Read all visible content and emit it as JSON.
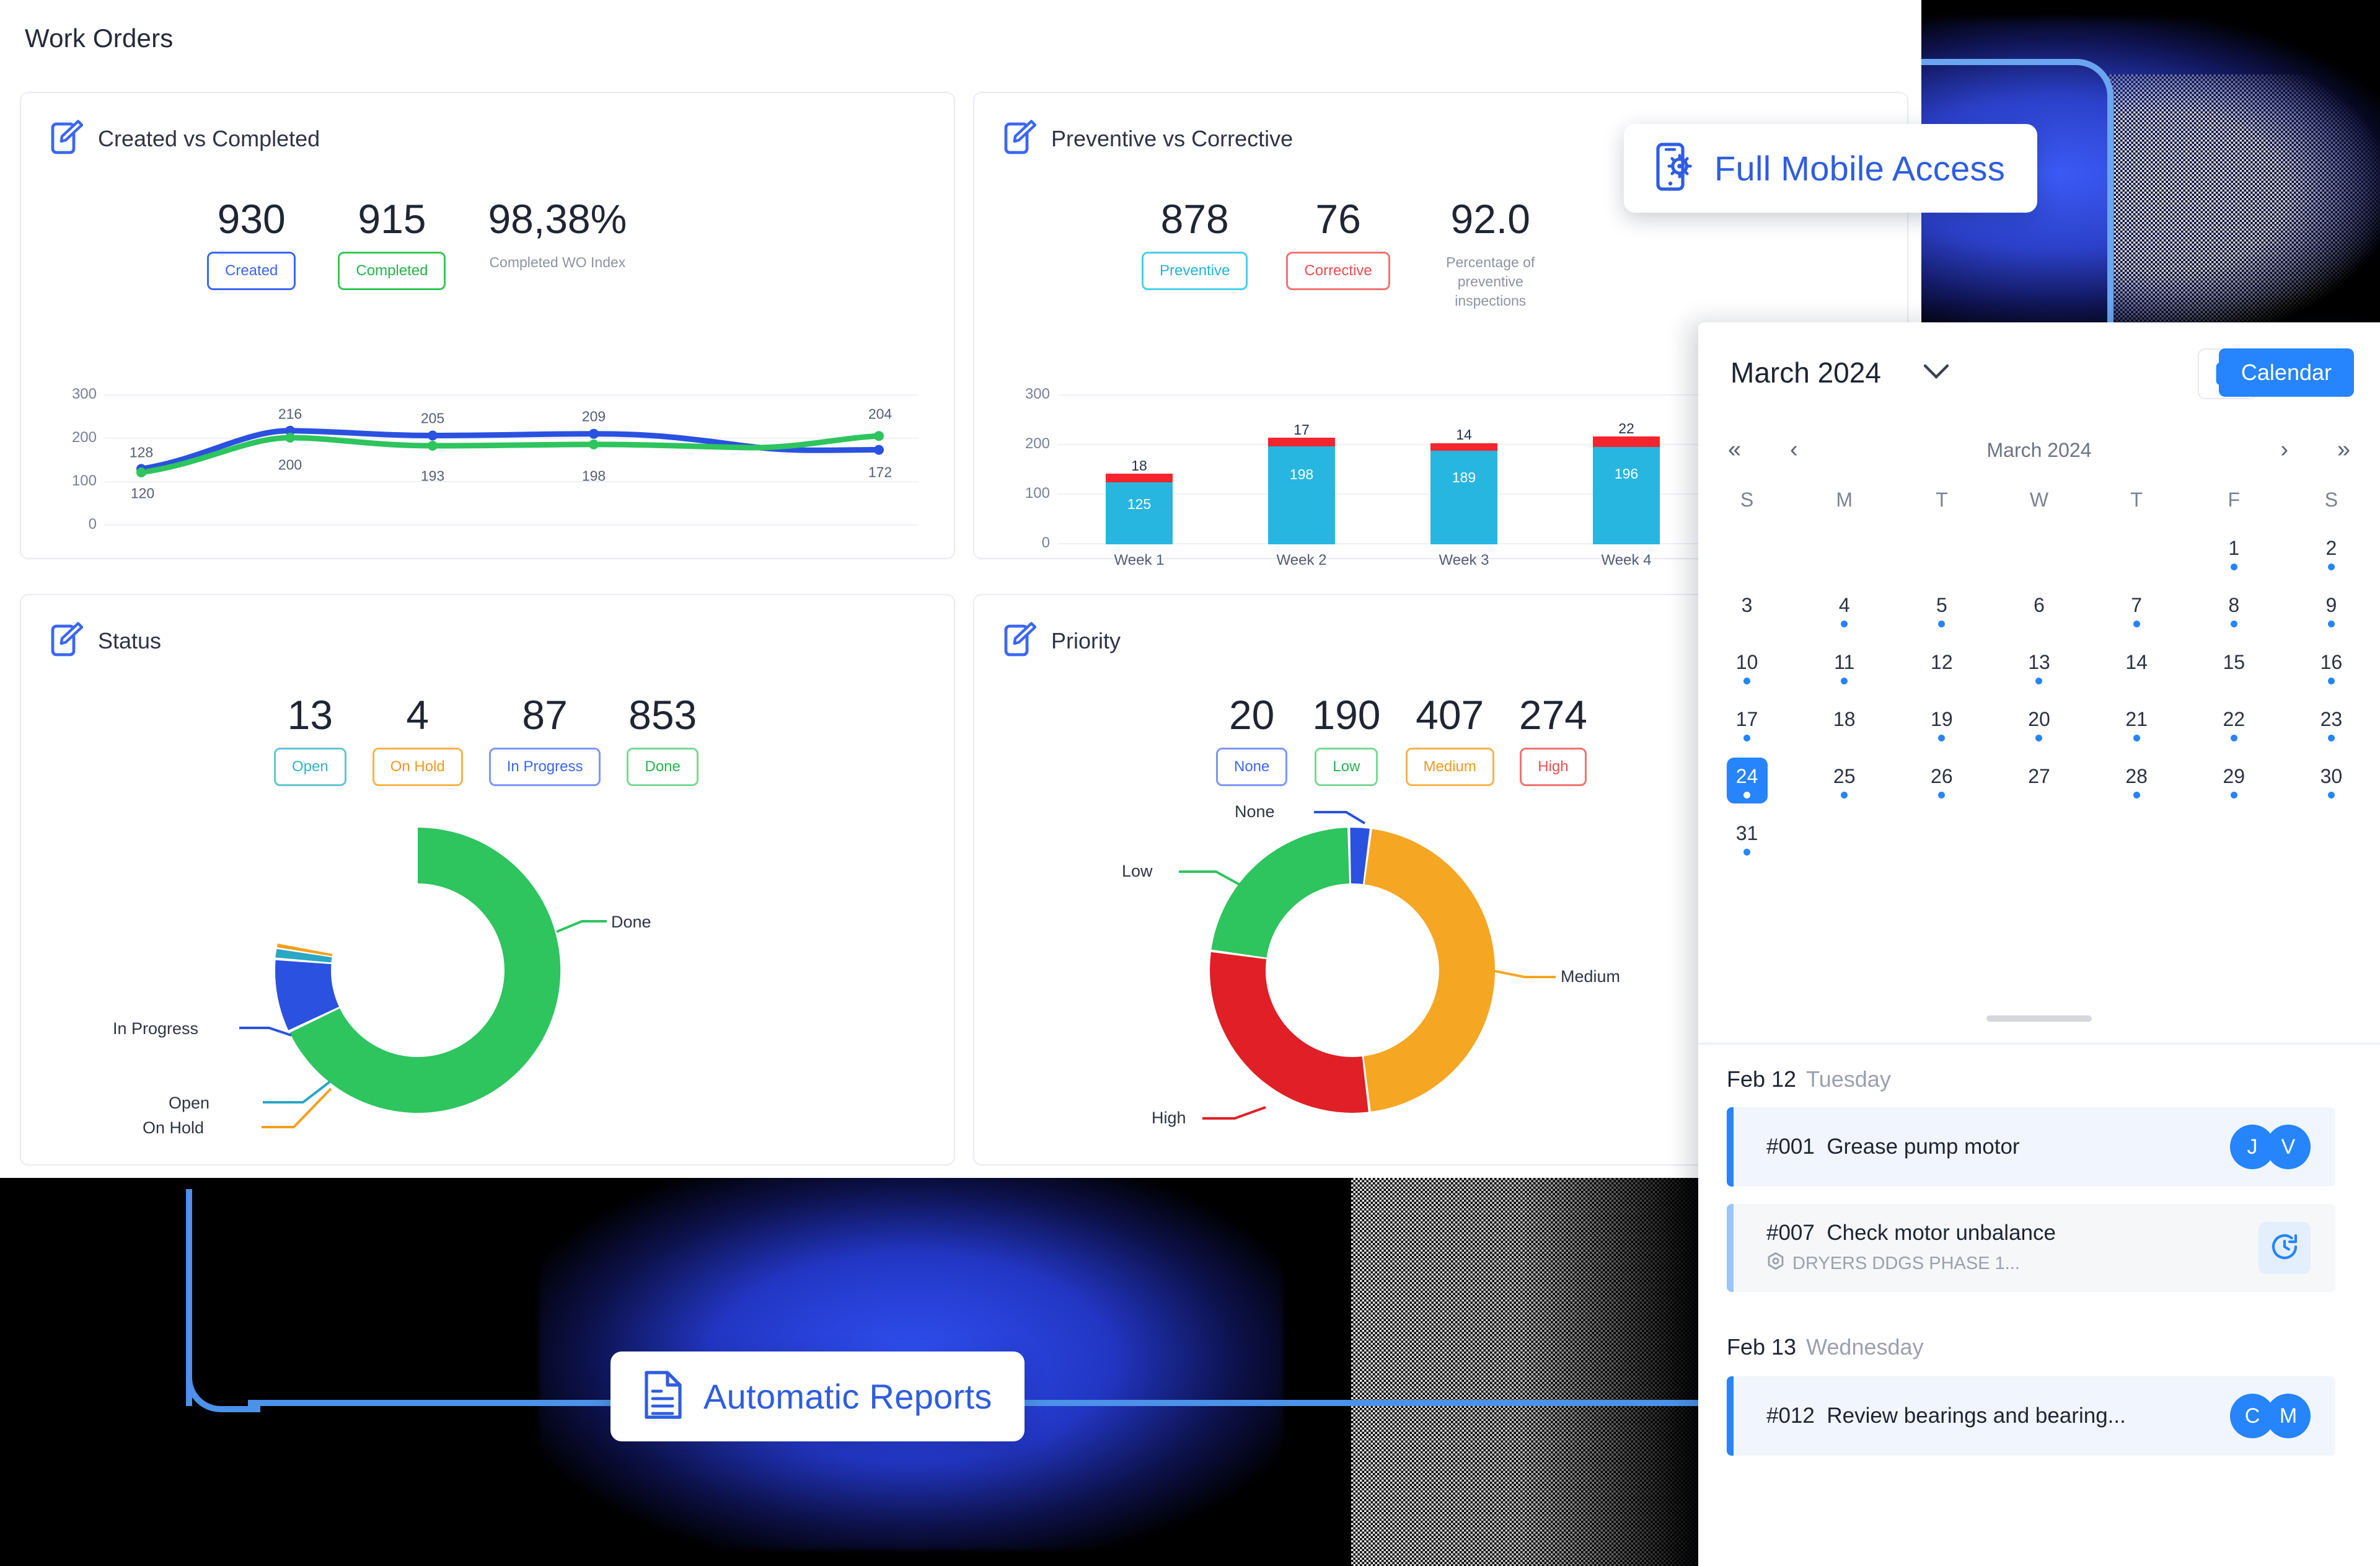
{
  "page": {
    "title": "Work Orders"
  },
  "cards": {
    "created_vs_completed": {
      "title": "Created vs Completed",
      "icon": "edit-document-icon",
      "kpis": [
        {
          "value": "930",
          "chip": "Created"
        },
        {
          "value": "915",
          "chip": "Completed"
        },
        {
          "value": "98,38%",
          "sub": "Completed WO Index"
        }
      ]
    },
    "preventive_vs_corrective": {
      "title": "Preventive vs Corrective",
      "icon": "edit-document-icon",
      "kpis": [
        {
          "value": "878",
          "chip": "Preventive"
        },
        {
          "value": "76",
          "chip": "Corrective"
        },
        {
          "value": "92.0",
          "sub": "Percentage of preventive inspections"
        }
      ]
    },
    "status": {
      "title": "Status",
      "icon": "edit-document-icon",
      "kpis": [
        {
          "value": "13",
          "chip": "Open"
        },
        {
          "value": "4",
          "chip": "On Hold"
        },
        {
          "value": "87",
          "chip": "In Progress"
        },
        {
          "value": "853",
          "chip": "Done"
        }
      ]
    },
    "priority": {
      "title": "Priority",
      "icon": "edit-document-icon",
      "kpis": [
        {
          "value": "20",
          "chip": "None"
        },
        {
          "value": "190",
          "chip": "Low"
        },
        {
          "value": "407",
          "chip": "Medium"
        },
        {
          "value": "274",
          "chip": "High"
        }
      ]
    }
  },
  "chart_data": [
    {
      "type": "line",
      "title": "Created vs Completed",
      "x": [
        "1",
        "2",
        "3",
        "4",
        "5"
      ],
      "series": [
        {
          "name": "Created",
          "color": "#2a51e0",
          "values": [
            128,
            216,
            205,
            209,
            172
          ]
        },
        {
          "name": "Completed",
          "color": "#2ec45e",
          "values": [
            120,
            200,
            193,
            198,
            204
          ]
        }
      ],
      "ylabel": "",
      "xlabel": "",
      "yticks": [
        0,
        100,
        200,
        300
      ],
      "ylim": [
        0,
        300
      ],
      "grid": true,
      "legend": "none"
    },
    {
      "type": "bar",
      "title": "Preventive vs Corrective",
      "categories": [
        "Week 1",
        "Week 2",
        "Week 3",
        "Week 4"
      ],
      "series": [
        {
          "name": "Preventive",
          "color": "#27b6e0",
          "values": [
            125,
            198,
            189,
            196
          ]
        },
        {
          "name": "Corrective",
          "color": "#f5252d",
          "values": [
            18,
            17,
            14,
            22
          ]
        }
      ],
      "stacked": true,
      "yticks": [
        0,
        100,
        200,
        300
      ],
      "ylim": [
        0,
        300
      ],
      "grid": true,
      "legend": "none"
    },
    {
      "type": "pie",
      "title": "Status",
      "labels": [
        "Done",
        "In Progress",
        "Open",
        "On Hold"
      ],
      "values": [
        853,
        87,
        13,
        4
      ],
      "colors": [
        "#2ec45e",
        "#2a51e0",
        "#2aa7c4",
        "#f3a01c"
      ],
      "donut": true,
      "legend": "callout"
    },
    {
      "type": "pie",
      "title": "Priority",
      "labels": [
        "Medium",
        "High",
        "Low",
        "None"
      ],
      "values": [
        407,
        274,
        190,
        20
      ],
      "colors": [
        "#f5a623",
        "#e01f26",
        "#2ec45e",
        "#2a51e0"
      ],
      "donut": true,
      "legend": "callout"
    }
  ],
  "pills": [
    {
      "label": "Full Mobile Access",
      "icon": "mobile-settings-icon"
    },
    {
      "label": "Automatic Reports",
      "icon": "document-report-icon"
    }
  ],
  "calendar": {
    "selected_month": "March 2024",
    "month_caret": "chevron-down-icon",
    "today_button_icon": "calendar-icon",
    "view_button": "Calendar",
    "nav": {
      "first": "«",
      "prev": "‹",
      "title": "March 2024",
      "next": "›",
      "last": "»"
    },
    "dow": [
      "S",
      "M",
      "T",
      "W",
      "T",
      "F",
      "S"
    ],
    "weeks": [
      [
        {
          "d": "",
          "dot": false,
          "sel": false
        },
        {
          "d": "",
          "dot": false,
          "sel": false
        },
        {
          "d": "",
          "dot": false,
          "sel": false
        },
        {
          "d": "",
          "dot": false,
          "sel": false
        },
        {
          "d": "",
          "dot": false,
          "sel": false
        },
        {
          "d": "1",
          "dot": true,
          "sel": false
        },
        {
          "d": "2",
          "dot": true,
          "sel": false
        }
      ],
      [
        {
          "d": "3",
          "dot": false,
          "sel": false
        },
        {
          "d": "4",
          "dot": true,
          "sel": false
        },
        {
          "d": "5",
          "dot": true,
          "sel": false
        },
        {
          "d": "6",
          "dot": false,
          "sel": false
        },
        {
          "d": "7",
          "dot": true,
          "sel": false
        },
        {
          "d": "8",
          "dot": true,
          "sel": false
        },
        {
          "d": "9",
          "dot": true,
          "sel": false
        }
      ],
      [
        {
          "d": "10",
          "dot": true,
          "sel": false
        },
        {
          "d": "11",
          "dot": true,
          "sel": false
        },
        {
          "d": "12",
          "dot": false,
          "sel": false
        },
        {
          "d": "13",
          "dot": true,
          "sel": false
        },
        {
          "d": "14",
          "dot": false,
          "sel": false
        },
        {
          "d": "15",
          "dot": false,
          "sel": false
        },
        {
          "d": "16",
          "dot": true,
          "sel": false
        }
      ],
      [
        {
          "d": "17",
          "dot": true,
          "sel": false
        },
        {
          "d": "18",
          "dot": false,
          "sel": false
        },
        {
          "d": "19",
          "dot": true,
          "sel": false
        },
        {
          "d": "20",
          "dot": true,
          "sel": false
        },
        {
          "d": "21",
          "dot": true,
          "sel": false
        },
        {
          "d": "22",
          "dot": true,
          "sel": false
        },
        {
          "d": "23",
          "dot": true,
          "sel": false
        }
      ],
      [
        {
          "d": "24",
          "dot": true,
          "sel": true
        },
        {
          "d": "25",
          "dot": true,
          "sel": false
        },
        {
          "d": "26",
          "dot": true,
          "sel": false
        },
        {
          "d": "27",
          "dot": false,
          "sel": false
        },
        {
          "d": "28",
          "dot": true,
          "sel": false
        },
        {
          "d": "29",
          "dot": true,
          "sel": false
        },
        {
          "d": "30",
          "dot": true,
          "sel": false
        }
      ],
      [
        {
          "d": "31",
          "dot": true,
          "sel": false
        },
        {
          "d": "",
          "dot": false,
          "sel": false
        },
        {
          "d": "",
          "dot": false,
          "sel": false
        },
        {
          "d": "",
          "dot": false,
          "sel": false
        },
        {
          "d": "",
          "dot": false,
          "sel": false
        },
        {
          "d": "",
          "dot": false,
          "sel": false
        },
        {
          "d": "",
          "dot": false,
          "sel": false
        }
      ]
    ],
    "agenda": [
      {
        "date": "Feb 12",
        "weekday": "Tuesday",
        "tasks": [
          {
            "id": "#001",
            "name": "Grease pump motor",
            "asset": "",
            "avatars": [
              "J",
              "V"
            ],
            "clock": false,
            "highlight": true
          },
          {
            "id": "#007",
            "name": "Check motor unbalance",
            "asset": "DRYERS DDGS PHASE 1...",
            "avatars": [],
            "clock": true,
            "highlight": false
          }
        ]
      },
      {
        "date": "Feb 13",
        "weekday": "Wednesday",
        "tasks": [
          {
            "id": "#012",
            "name": "Review bearings and bearing...",
            "asset": "",
            "avatars": [
              "C",
              "M"
            ],
            "clock": false,
            "highlight": true
          }
        ]
      }
    ]
  },
  "colors": {
    "accent": "#2684fc",
    "blue": "#2a51e0",
    "green": "#2ec45e",
    "cyan": "#27b6e0",
    "red": "#f5252d",
    "orange": "#f5a623"
  }
}
